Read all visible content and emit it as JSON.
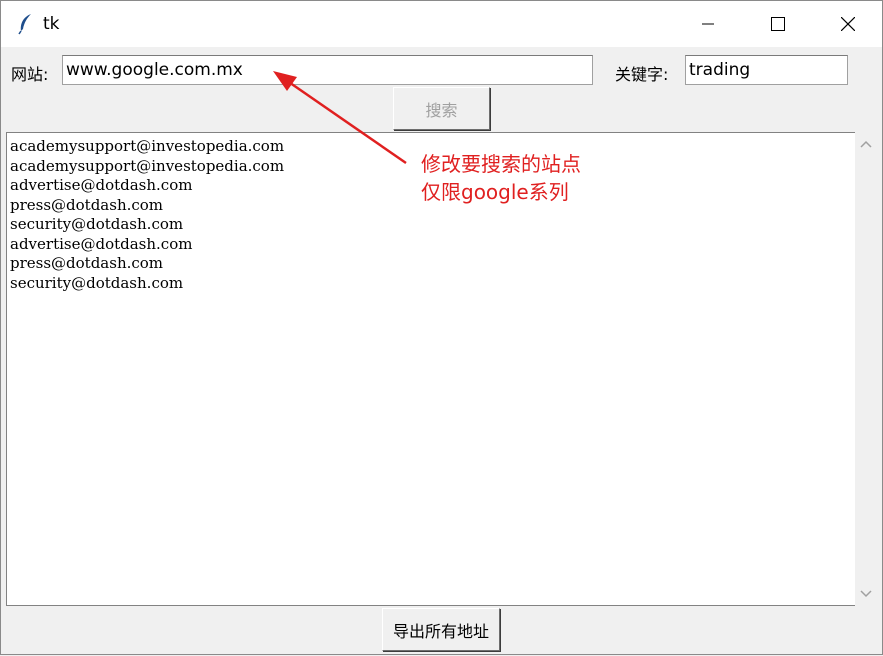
{
  "window": {
    "title": "tk"
  },
  "form": {
    "site_label": "网站:",
    "site_value": "www.google.com.mx",
    "keyword_label": "关键字:",
    "keyword_value": "trading",
    "search_button": "搜索"
  },
  "results": [
    "academysupport@investopedia.com",
    "academysupport@investopedia.com",
    "advertise@dotdash.com",
    "press@dotdash.com",
    "security@dotdash.com",
    "advertise@dotdash.com",
    "press@dotdash.com",
    "security@dotdash.com"
  ],
  "export_button": "导出所有地址",
  "annotation": {
    "line1": "修改要搜索的站点",
    "line2": "仅限google系列",
    "color": "#e02020"
  },
  "icons": {
    "app": "feather-icon",
    "minimize": "minimize-icon",
    "maximize": "maximize-icon",
    "close": "close-icon",
    "scroll_up": "chevron-up-icon",
    "scroll_down": "chevron-down-icon"
  }
}
